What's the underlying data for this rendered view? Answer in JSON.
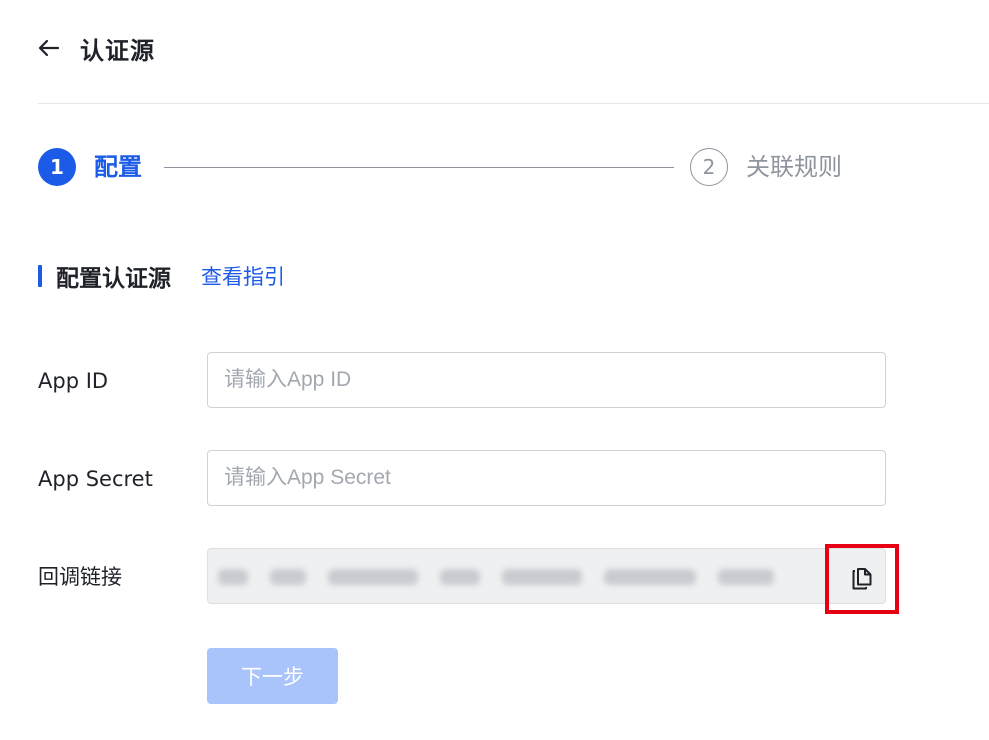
{
  "header": {
    "back_icon": "arrow-left-icon",
    "title": "认证源"
  },
  "steps": [
    {
      "number": "1",
      "label": "配置",
      "status": "active"
    },
    {
      "number": "2",
      "label": "关联规则",
      "status": "pending"
    }
  ],
  "section": {
    "title": "配置认证源",
    "guide_link": "查看指引"
  },
  "form": {
    "app_id": {
      "label": "App ID",
      "placeholder": "请输入App ID",
      "value": ""
    },
    "app_secret": {
      "label": "App Secret",
      "placeholder": "请输入App Secret",
      "value": ""
    },
    "callback_url": {
      "label": "回调链接",
      "copy_icon": "copy-icon",
      "blurred": true
    }
  },
  "actions": {
    "next_label": "下一步",
    "next_disabled": true
  },
  "colors": {
    "primary": "#1c5ae8",
    "disabled_button": "#a9c3fb",
    "highlight_box": "#e60012",
    "muted_text": "#8f959e"
  }
}
